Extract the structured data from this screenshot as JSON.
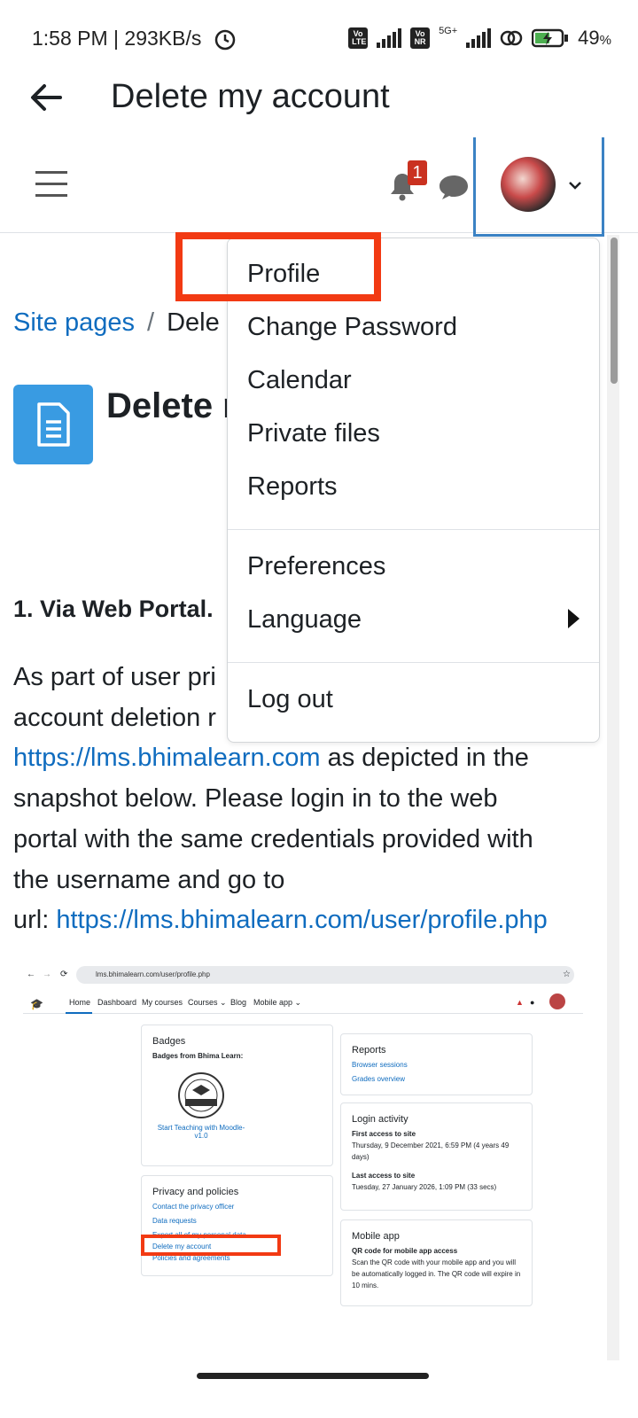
{
  "status_bar": {
    "time": "1:58 PM | 293KB/s",
    "battery": "49",
    "battery_unit": "%",
    "sim_badges": [
      "Vo LTE",
      "Vo NR"
    ],
    "net_label": "5G+"
  },
  "app_bar": {
    "title": "Delete my account",
    "back_icon": "arrow-left-icon"
  },
  "navbar": {
    "notification_count": "1",
    "icons": [
      "hamburger-icon",
      "bell-icon",
      "chat-icon",
      "chevron-down-icon"
    ]
  },
  "breadcrumb": {
    "items": [
      "Site pages",
      "Dele"
    ]
  },
  "page": {
    "heading": "Delete r",
    "section_heading": "1. Via Web Portal.",
    "para_lines": [
      "As part of user pri",
      "account deletion r",
      "snapshot below. Please login in to the web",
      "portal with the same credentials provided with",
      "the username and go to"
    ],
    "link1": "https://lms.bhimalearn.com",
    "link1_suffix": " as depicted in the",
    "url_prefix": "url: ",
    "link2": "https://lms.bhimalearn.com/user/profile.php"
  },
  "user_menu": {
    "items": [
      "Profile",
      "Change Password",
      "Calendar",
      "Private files",
      "Reports",
      "Preferences",
      "Language",
      "Log out"
    ]
  },
  "snapshot": {
    "url": "lms.bhimalearn.com/user/profile.php",
    "nav": [
      "Home",
      "Dashboard",
      "My courses",
      "Courses ⌄",
      "Blog",
      "Mobile app ⌄"
    ],
    "badges": {
      "title": "Badges",
      "subtitle": "Badges from Bhima Learn:",
      "badge_label": "Start Teaching with Moodle-v1.0"
    },
    "privacy": {
      "title": "Privacy and policies",
      "links": [
        "Contact the privacy officer",
        "Data requests",
        "Export all of my personal data",
        "Delete my account",
        "Policies and agreements"
      ]
    },
    "reports": {
      "title": "Reports",
      "links": [
        "Browser sessions",
        "Grades overview"
      ]
    },
    "login": {
      "title": "Login activity",
      "first_label": "First access to site",
      "first_value": "Thursday, 9 December 2021, 6:59 PM  (4 years 49 days)",
      "last_label": "Last access to site",
      "last_value": "Tuesday, 27 January 2026, 1:09 PM  (33 secs)"
    },
    "mobile": {
      "title": "Mobile app",
      "subtitle": "QR code for mobile app access",
      "text": "Scan the QR code with your mobile app and you will be automatically logged in. The QR code will expire in 10 mins."
    }
  },
  "colors": {
    "link": "#0f6cbf",
    "highlight": "#f23a13",
    "user_menu_border": "#3b82c4",
    "page_icon_bg": "#399be2",
    "badge_bg": "#ca3120"
  }
}
